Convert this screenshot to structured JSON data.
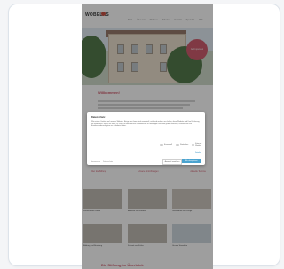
{
  "page": {
    "logo": "WOBELAS",
    "nav": [
      "Start",
      "Über uns",
      "Wohnen",
      "Arbeiten",
      "Kontakt",
      "Spenden",
      "Hilfe"
    ],
    "hero_badge": "Jetzt spenden",
    "welcome_heading": "Willkommen!",
    "links": [
      "Über die Stiftung",
      "Unsere Einrichtungen",
      "Aktuelle Termine"
    ],
    "tile_captions": [
      "Wohnen und Leben",
      "Arbeiten und Fördern",
      "Gesundheit und Pflege",
      "Bildung und Beratung",
      "Freizeit und Kultur",
      "Unsere Standorte"
    ],
    "section_heading": "Die Stiftung im Überblick"
  },
  "cookie_modal": {
    "title": "Datenschutz",
    "text": "Wir nutzen Cookies auf unserer Website. Einige von ihnen sind essenziell, während andere uns helfen, diese Website und Ihre Erfahrung zu verbessern. Wenn Sie unter 16 Jahre alt sind und Ihre Zustimmung zu freiwilligen Diensten geben möchten, müssen Sie Ihre Erziehungsberechtigten um Erlaubnis bitten.",
    "toggles": [
      "Essenziell",
      "Statistiken",
      "Externe Medien"
    ],
    "details_link": "Details",
    "footer_links": [
      "Impressum",
      "Datenschutz"
    ],
    "btn_selection": "Auswahl speichern",
    "btn_accept": "Alle akzeptieren"
  },
  "colors": {
    "accent": "#c9485b",
    "accept_button": "#4aa3cf",
    "overlay": "rgba(40,40,40,0.45)"
  }
}
